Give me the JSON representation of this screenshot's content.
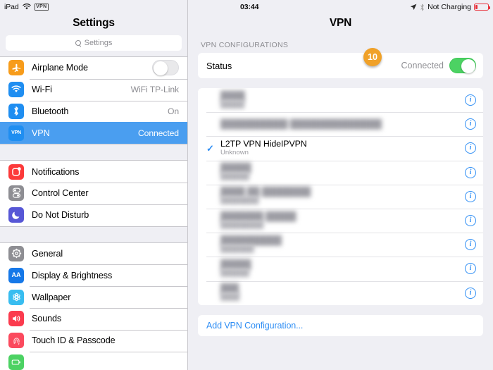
{
  "sidebar": {
    "status_bar": {
      "device": "iPad",
      "wifi_icon": "wifi-icon",
      "vpn_chip": "VPN"
    },
    "title": "Settings",
    "search": {
      "placeholder": "Settings",
      "icon": "search-icon"
    },
    "groups": [
      {
        "items": [
          {
            "label": "Airplane Mode",
            "icon": "airplane-icon",
            "value": "",
            "control": "toggle-off",
            "selected": false
          },
          {
            "label": "Wi-Fi",
            "icon": "wifi-icon",
            "value": "WiFi TP-Link",
            "control": "",
            "selected": false
          },
          {
            "label": "Bluetooth",
            "icon": "bluetooth-icon",
            "value": "On",
            "control": "",
            "selected": false
          },
          {
            "label": "VPN",
            "icon": "vpn-icon",
            "value": "Connected",
            "control": "",
            "selected": true
          }
        ]
      },
      {
        "items": [
          {
            "label": "Notifications",
            "icon": "notifications-icon",
            "value": "",
            "control": "",
            "selected": false
          },
          {
            "label": "Control Center",
            "icon": "control-center-icon",
            "value": "",
            "control": "",
            "selected": false
          },
          {
            "label": "Do Not Disturb",
            "icon": "do-not-disturb-icon",
            "value": "",
            "control": "",
            "selected": false
          }
        ]
      },
      {
        "items": [
          {
            "label": "General",
            "icon": "gear-icon",
            "value": "",
            "control": "",
            "selected": false
          },
          {
            "label": "Display & Brightness",
            "icon": "display-brightness-icon",
            "value": "",
            "control": "",
            "selected": false
          },
          {
            "label": "Wallpaper",
            "icon": "wallpaper-icon",
            "value": "",
            "control": "",
            "selected": false
          },
          {
            "label": "Sounds",
            "icon": "sounds-icon",
            "value": "",
            "control": "",
            "selected": false
          },
          {
            "label": "Touch ID & Passcode",
            "icon": "touch-id-icon",
            "value": "",
            "control": "",
            "selected": false
          },
          {
            "label": "",
            "icon": "battery-icon",
            "value": "",
            "control": "",
            "selected": false
          }
        ]
      }
    ]
  },
  "detail": {
    "status_bar": {
      "clock": "03:44",
      "location_icon": "location-arrow-icon",
      "bluetooth_icon": "bluetooth-icon",
      "charging_text": "Not Charging",
      "battery_icon": "battery-low-icon"
    },
    "title": "VPN",
    "section_header": "VPN CONFIGURATIONS",
    "status": {
      "label": "Status",
      "value": "Connected",
      "toggle_state": "on",
      "toggle_color": "#4cd263"
    },
    "badge": {
      "number": "10",
      "color": "#f0a128"
    },
    "configurations": [
      {
        "name": "████",
        "sub": "█████",
        "selected": false,
        "redacted": true
      },
      {
        "name": "███████████ ███████████████",
        "sub": "",
        "selected": false,
        "redacted": true
      },
      {
        "name": "L2TP VPN HideIPVPN",
        "sub": "Unknown",
        "selected": true,
        "redacted": false
      },
      {
        "name": "█████",
        "sub": "██████",
        "selected": false,
        "redacted": true
      },
      {
        "name": "████ ██ ████████",
        "sub": "████████",
        "selected": false,
        "redacted": true
      },
      {
        "name": "███████ █████",
        "sub": "█████████",
        "selected": false,
        "redacted": true
      },
      {
        "name": "██████████",
        "sub": "███████",
        "selected": false,
        "redacted": true
      },
      {
        "name": "█████",
        "sub": "██████",
        "selected": false,
        "redacted": true
      },
      {
        "name": "███",
        "sub": "████",
        "selected": false,
        "redacted": true
      }
    ],
    "info_button_label": "i",
    "add_configuration": "Add VPN Configuration..."
  }
}
